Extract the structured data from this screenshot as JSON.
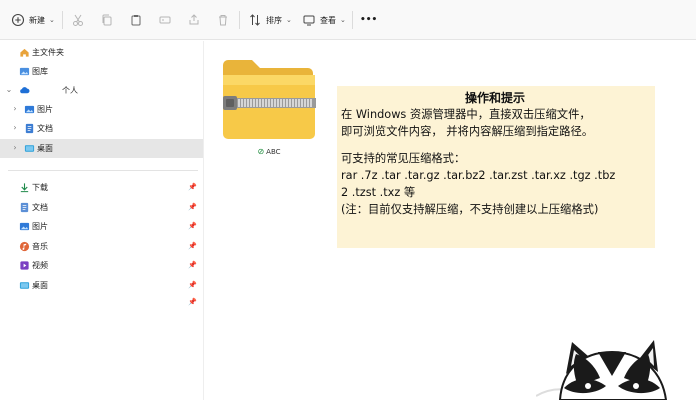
{
  "toolbar": {
    "new_label": "新建",
    "sort_label": "排序",
    "view_label": "查看",
    "more_label": "•••"
  },
  "sidebar": {
    "top_items": [
      {
        "label": "主文件夹",
        "icon": "home-icon"
      },
      {
        "label": "图库",
        "icon": "gallery-icon"
      },
      {
        "label": "个人",
        "icon": "onedrive-cloud-icon"
      },
      {
        "label": "图片",
        "icon": "pictures-folder-icon"
      },
      {
        "label": "文档",
        "icon": "documents-folder-icon"
      },
      {
        "label": "桌面",
        "icon": "desktop-folder-icon"
      }
    ],
    "quick_items": [
      {
        "label": "下载",
        "icon": "download-icon"
      },
      {
        "label": "文档",
        "icon": "documents-icon"
      },
      {
        "label": "图片",
        "icon": "pictures-icon"
      },
      {
        "label": "音乐",
        "icon": "music-icon"
      },
      {
        "label": "视频",
        "icon": "video-icon"
      },
      {
        "label": "桌面",
        "icon": "desktop-icon"
      }
    ]
  },
  "content": {
    "file": {
      "name": "ABC",
      "status_icon": "sync-ok-icon"
    }
  },
  "tip": {
    "title": "操作和提示",
    "lines": [
      "在 Windows 资源管理器中，直接双击压缩文件，",
      "即可浏览文件内容， 并将内容解压缩到指定路径。",
      "",
      "可支持的常见压缩格式：",
      "rar .7z .tar .tar.gz .tar.bz2 .tar.zst .tar.xz .tgz .tbz",
      "2 .tzst .txz 等",
      "(注：目前仅支持解压缩，不支持创建以上压缩格式)"
    ]
  },
  "colors": {
    "tip_background": "#fdf3d5",
    "selected_nav": "#e6e6e6",
    "folder_yellow": "#f7c948",
    "accent_blue": "#2b6fd6"
  }
}
